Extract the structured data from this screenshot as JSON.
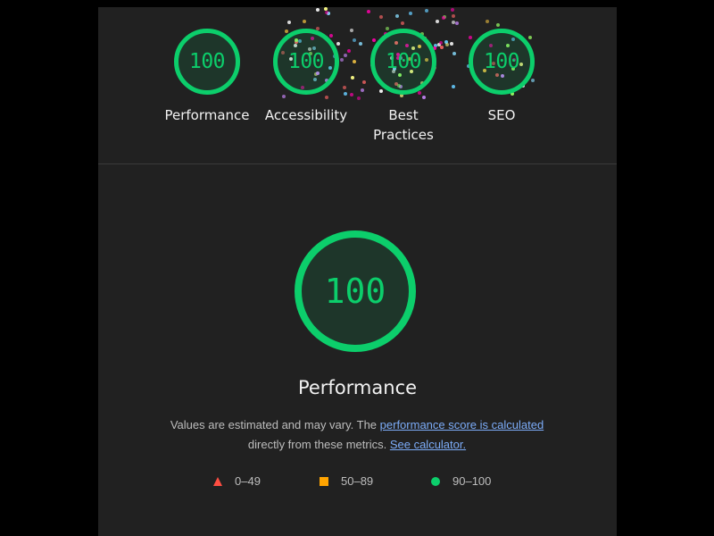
{
  "colors": {
    "pass": "#0cce6b",
    "average": "#ffa400",
    "fail": "#ff4e42",
    "link": "#7cacf8",
    "background": "#212121"
  },
  "categories": [
    {
      "score": "100",
      "label": "Performance"
    },
    {
      "score": "100",
      "label": "Accessibility"
    },
    {
      "score": "100",
      "label": "Best Practices"
    },
    {
      "score": "100",
      "label": "SEO"
    }
  ],
  "performance": {
    "score": "100",
    "title": "Performance",
    "desc_pre": "Values are estimated and may vary. The ",
    "desc_link1": "performance score is calculated",
    "desc_mid": " directly from these metrics. ",
    "desc_link2": "See calculator."
  },
  "legend": [
    {
      "icon": "triangle-icon",
      "range": "0–49"
    },
    {
      "icon": "square-icon",
      "range": "50–89"
    },
    {
      "icon": "circle-icon",
      "range": "90–100"
    }
  ]
}
